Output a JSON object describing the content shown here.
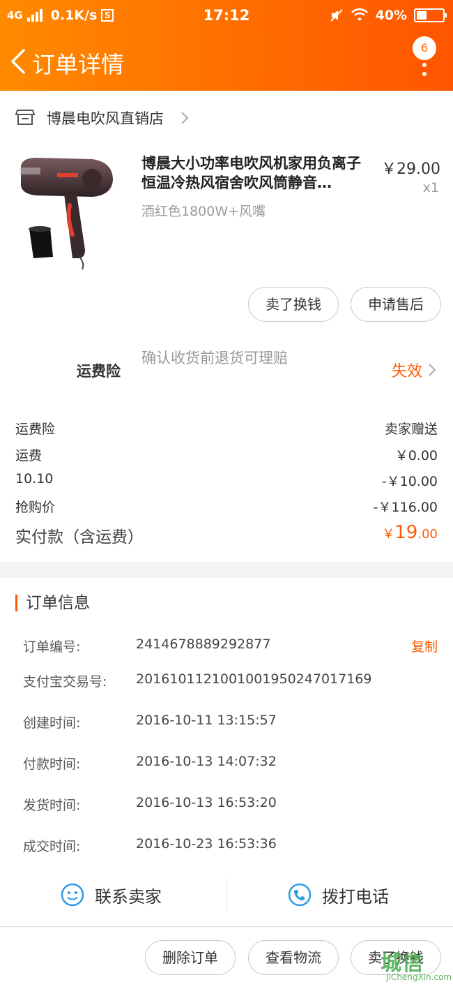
{
  "status_bar": {
    "network": "4G",
    "speed": "0.1K/s",
    "s_icon": "S",
    "time": "17:12",
    "battery": "40%"
  },
  "nav": {
    "title": "订单详情",
    "badge": "6"
  },
  "shop": {
    "name": "博晨电吹风直销店"
  },
  "product": {
    "title": "博晨大小功率电吹风机家用负离子恒温冷热风宿舍吹风筒静音…",
    "spec": "酒红色1800W+风嘴",
    "price": "￥29.00",
    "qty": "x1"
  },
  "actions": {
    "sell": "卖了换钱",
    "after_sale": "申请售后"
  },
  "insurance": {
    "label": "运费险",
    "desc": "确认收货前退货可理赔",
    "status": "失效"
  },
  "fees": [
    {
      "k": "运费险",
      "v": "卖家赠送"
    },
    {
      "k": "运费",
      "v": "￥0.00"
    },
    {
      "k": "10.10",
      "v": "-￥10.00"
    },
    {
      "k": "抢购价",
      "v": "-￥116.00"
    }
  ],
  "total": {
    "label": "实付款（含运费）",
    "currency": "￥",
    "int": "19",
    "dec": ".00"
  },
  "order_info": {
    "title": "订单信息",
    "copy": "复制",
    "rows": [
      {
        "k": "订单编号:",
        "v": "2414678889292877"
      },
      {
        "k": "支付宝交易号:",
        "v": "2016101121001001950247017169"
      },
      {
        "k": "创建时间:",
        "v": "2016-10-11 13:15:57"
      },
      {
        "k": "付款时间:",
        "v": "2016-10-13 14:07:32"
      },
      {
        "k": "发货时间:",
        "v": "2016-10-13 16:53:20"
      },
      {
        "k": "成交时间:",
        "v": "2016-10-23 16:53:36"
      }
    ]
  },
  "contact": {
    "seller": "联系卖家",
    "call": "拨打电话"
  },
  "bottom": {
    "delete": "删除订单",
    "logistics": "查看物流",
    "sell": "卖了换钱"
  },
  "watermark": {
    "logo": "城信",
    "url": "JiChengXin.com"
  },
  "colors": {
    "accent": "#ff6a00",
    "price": "#ff5a00",
    "link_blue": "#2a9ce6"
  }
}
